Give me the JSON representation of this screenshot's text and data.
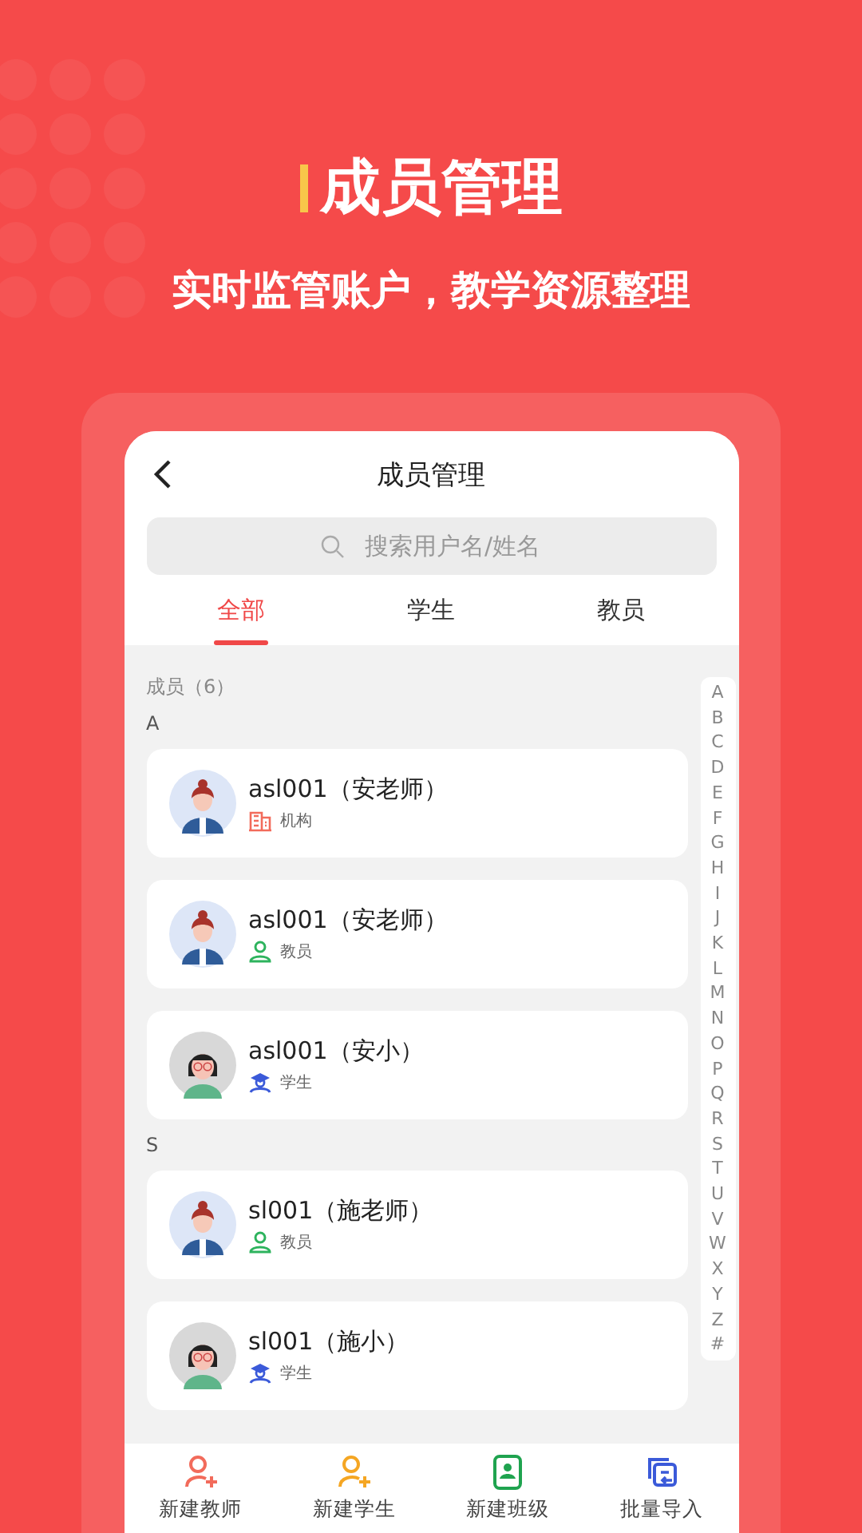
{
  "banner": {
    "title": "成员管理",
    "subtitle": "实时监管账户，教学资源整理"
  },
  "header": {
    "title": "成员管理"
  },
  "search": {
    "placeholder": "搜索用户名/姓名"
  },
  "tabs": [
    {
      "label": "全部",
      "selected": true
    },
    {
      "label": "学生",
      "selected": false
    },
    {
      "label": "教员",
      "selected": false
    }
  ],
  "member_count": "成员（6）",
  "groups": [
    {
      "letter": "A",
      "members": [
        {
          "name": "asl001（安老师）",
          "role": "机构",
          "kind": "org"
        },
        {
          "name": "asl001（安老师）",
          "role": "教员",
          "kind": "teacher"
        },
        {
          "name": "asl001（安小）",
          "role": "学生",
          "kind": "student"
        }
      ]
    },
    {
      "letter": "S",
      "members": [
        {
          "name": "sl001（施老师）",
          "role": "教员",
          "kind": "teacher"
        },
        {
          "name": "sl001（施小）",
          "role": "学生",
          "kind": "student"
        }
      ]
    }
  ],
  "index_letters": [
    "A",
    "B",
    "C",
    "D",
    "E",
    "F",
    "G",
    "H",
    "I",
    "J",
    "K",
    "L",
    "M",
    "N",
    "O",
    "P",
    "Q",
    "R",
    "S",
    "T",
    "U",
    "V",
    "W",
    "X",
    "Y",
    "Z",
    "#"
  ],
  "actions": [
    {
      "label": "新建教师",
      "kind": "new-teacher"
    },
    {
      "label": "新建学生",
      "kind": "new-student"
    },
    {
      "label": "新建班级",
      "kind": "new-class"
    },
    {
      "label": "批量导入",
      "kind": "import"
    }
  ]
}
